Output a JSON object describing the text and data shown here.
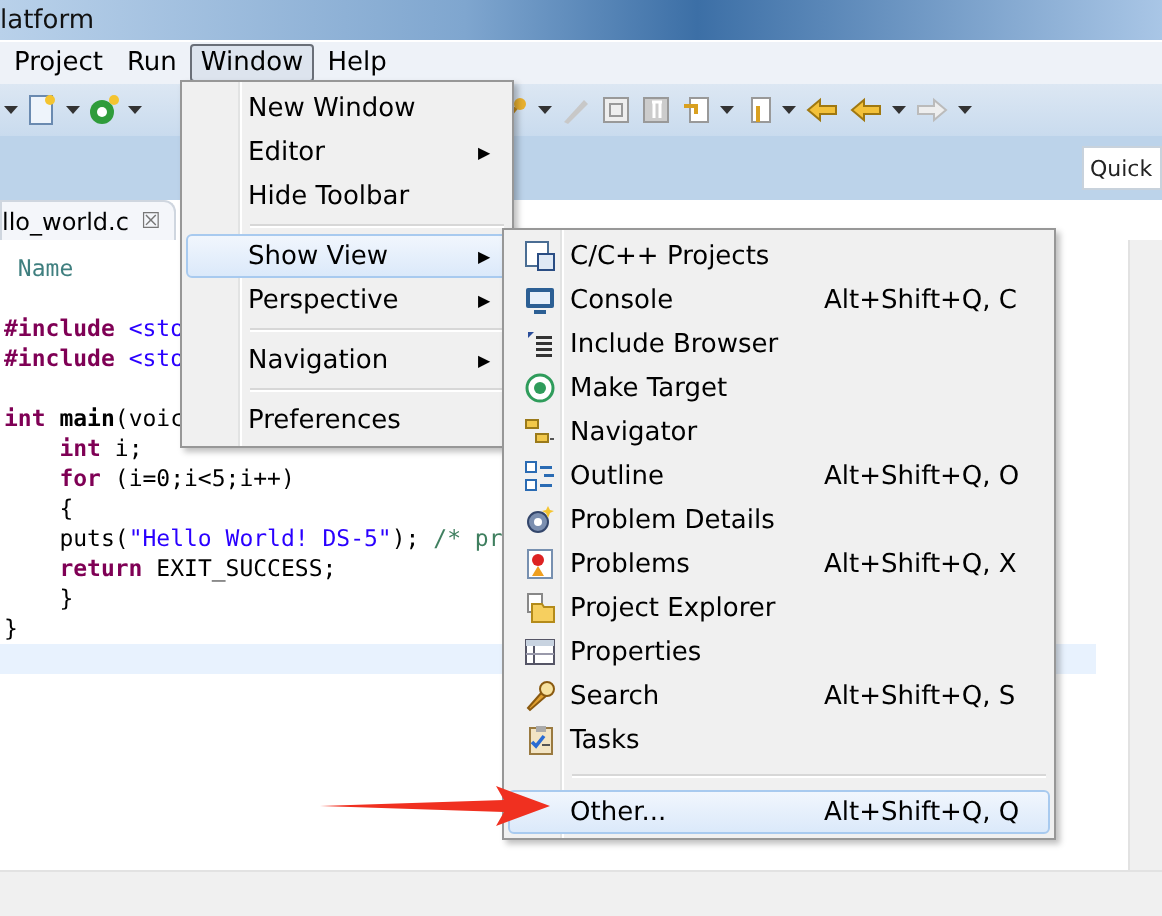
{
  "window": {
    "title": "latform"
  },
  "menubar": [
    {
      "label": "Project",
      "selected": false
    },
    {
      "label": "Run",
      "selected": false
    },
    {
      "label": "Window",
      "selected": true
    },
    {
      "label": "Help",
      "selected": false
    }
  ],
  "quick_access": {
    "placeholder": "Quick"
  },
  "editor_tab": {
    "label": "llo_world.c",
    "close": "☒"
  },
  "code": [
    {
      "kind": "code",
      "current": false,
      "tokens": [
        {
          "text": " Name",
          "kind": "doc"
        }
      ]
    },
    {
      "kind": "blank",
      "current": false
    },
    {
      "kind": "code",
      "current": false,
      "tokens": [
        {
          "text": "#include",
          "kind": "pre"
        },
        {
          "text": " <sto",
          "kind": "inc"
        }
      ]
    },
    {
      "kind": "code",
      "current": false,
      "tokens": [
        {
          "text": "#include",
          "kind": "pre"
        },
        {
          "text": " <sto",
          "kind": "inc"
        }
      ]
    },
    {
      "kind": "blank",
      "current": false
    },
    {
      "kind": "code",
      "current": false,
      "tokens": [
        {
          "text": "int",
          "kind": "kw"
        },
        {
          "text": " main",
          "kind": "fn"
        },
        {
          "text": "(voic",
          "kind": "plain"
        }
      ]
    },
    {
      "kind": "code",
      "current": false,
      "tokens": [
        {
          "text": "    int",
          "kind": "kw"
        },
        {
          "text": " i;",
          "kind": "plain"
        }
      ]
    },
    {
      "kind": "code",
      "current": false,
      "tokens": [
        {
          "text": "    for",
          "kind": "kw"
        },
        {
          "text": " (i=0;i<5;i++)",
          "kind": "plain"
        }
      ]
    },
    {
      "kind": "code",
      "current": false,
      "tokens": [
        {
          "text": "    {",
          "kind": "plain"
        }
      ]
    },
    {
      "kind": "code",
      "current": false,
      "tokens": [
        {
          "text": "    puts(",
          "kind": "plain"
        },
        {
          "text": "\"Hello World! DS-5\"",
          "kind": "str"
        },
        {
          "text": ");",
          "kind": "plain"
        },
        {
          "text": " /* pr",
          "kind": "com"
        }
      ]
    },
    {
      "kind": "code",
      "current": false,
      "tokens": [
        {
          "text": "    return",
          "kind": "kw"
        },
        {
          "text": " EXIT_SUCCESS;",
          "kind": "plain"
        }
      ]
    },
    {
      "kind": "code",
      "current": false,
      "tokens": [
        {
          "text": "    }",
          "kind": "plain"
        }
      ]
    },
    {
      "kind": "code",
      "current": false,
      "tokens": [
        {
          "text": "}",
          "kind": "plain"
        }
      ]
    },
    {
      "kind": "blank",
      "current": true
    }
  ],
  "window_menu": [
    {
      "kind": "item",
      "label": "New Window",
      "selected": false
    },
    {
      "kind": "submenu",
      "label": "Editor",
      "arrow": "▶",
      "selected": false
    },
    {
      "kind": "item",
      "label": "Hide Toolbar",
      "selected": false
    },
    {
      "kind": "separator"
    },
    {
      "kind": "submenu",
      "label": "Show View",
      "arrow": "▶",
      "selected": true
    },
    {
      "kind": "submenu",
      "label": "Perspective",
      "arrow": "▶",
      "selected": false
    },
    {
      "kind": "separator"
    },
    {
      "kind": "submenu",
      "label": "Navigation",
      "arrow": "▶",
      "selected": false
    },
    {
      "kind": "separator"
    },
    {
      "kind": "item",
      "label": "Preferences",
      "selected": false
    }
  ],
  "show_view_menu": [
    {
      "kind": "item",
      "label": "C/C++ Projects",
      "selected": false
    },
    {
      "kind": "item",
      "label": "Console",
      "shortcut": "Alt+Shift+Q, C",
      "selected": false
    },
    {
      "kind": "item",
      "label": "Include Browser",
      "selected": false
    },
    {
      "kind": "item",
      "label": "Make Target",
      "selected": false
    },
    {
      "kind": "item",
      "label": "Navigator",
      "selected": false
    },
    {
      "kind": "item",
      "label": "Outline",
      "shortcut": "Alt+Shift+Q, O",
      "selected": false
    },
    {
      "kind": "item",
      "label": "Problem Details",
      "selected": false
    },
    {
      "kind": "item",
      "label": "Problems",
      "shortcut": "Alt+Shift+Q, X",
      "selected": false
    },
    {
      "kind": "item",
      "label": "Project Explorer",
      "selected": false
    },
    {
      "kind": "item",
      "label": "Properties",
      "selected": false
    },
    {
      "kind": "item",
      "label": "Search",
      "shortcut": "Alt+Shift+Q, S",
      "selected": false
    },
    {
      "kind": "item",
      "label": "Tasks",
      "selected": false
    },
    {
      "kind": "separator"
    },
    {
      "kind": "item",
      "label": "Other...",
      "shortcut": "Alt+Shift+Q, Q",
      "selected": true
    }
  ]
}
